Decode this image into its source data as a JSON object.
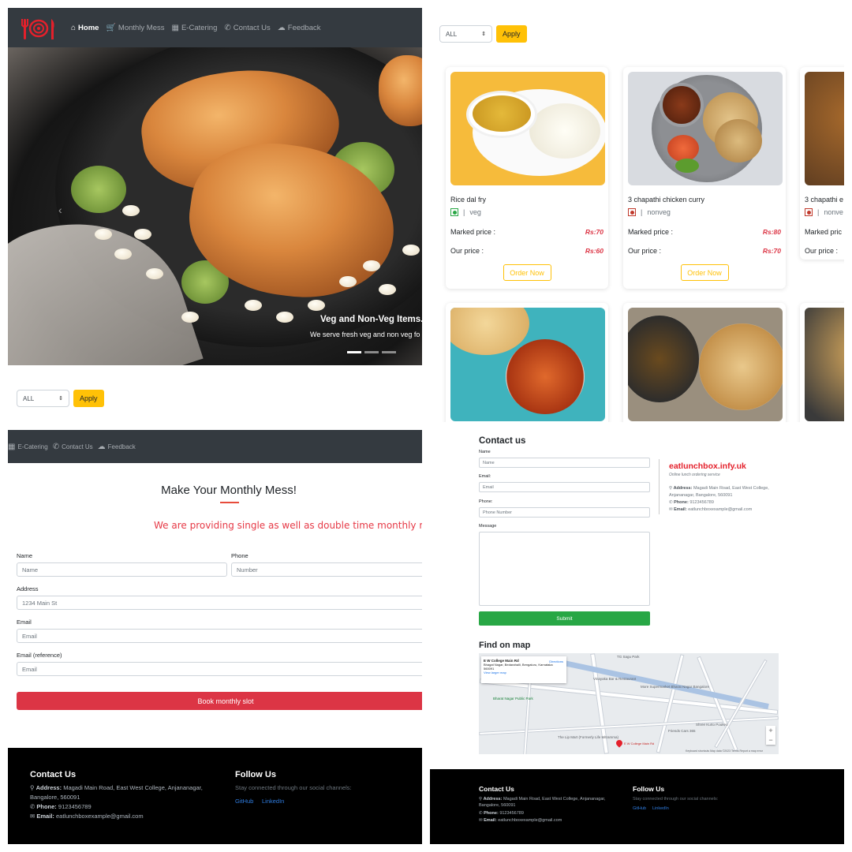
{
  "nav": {
    "items": [
      {
        "icon": "home-icon",
        "glyph": "🏠",
        "label": "Home"
      },
      {
        "icon": "cart-icon",
        "glyph": "🛒",
        "label": "Monthly Mess"
      },
      {
        "icon": "boxes-icon",
        "glyph": "📦",
        "label": "E-Catering"
      },
      {
        "icon": "phone-icon",
        "glyph": "✆",
        "label": "Contact Us"
      },
      {
        "icon": "cloud-icon",
        "glyph": "☁",
        "label": "Feedback"
      }
    ]
  },
  "hero": {
    "caption_title": "Veg and Non-Veg Items.",
    "caption_text": "We serve fresh veg and non veg fo"
  },
  "filter": {
    "selected": "ALL",
    "apply_label": "Apply"
  },
  "menu": {
    "cards": [
      {
        "name": "Rice dal fry",
        "type": "veg",
        "marked_label": "Marked price :",
        "marked": "Rs:70",
        "our_label": "Our price :",
        "our": "Rs:60",
        "order_label": "Order Now"
      },
      {
        "name": "3 chapathi chicken curry",
        "type": "nonveg",
        "marked_label": "Marked price :",
        "marked": "Rs:80",
        "our_label": "Our price :",
        "our": "Rs:70",
        "order_label": "Order Now"
      },
      {
        "name": "3 chapathi e",
        "type": "nonve",
        "marked_label": "Marked pric",
        "our_label": "Our price :"
      }
    ]
  },
  "monthly": {
    "nav_items": [
      "E-Catering",
      "Contact Us",
      "Feedback"
    ],
    "title": "Make Your Monthly Mess!",
    "subtitle": "We are providing single as well as double time monthly mess",
    "name_label": "Name",
    "name_placeholder": "Name",
    "phone_label": "Phone",
    "phone_placeholder": "Number",
    "address_label": "Address",
    "address_placeholder": "1234 Main St",
    "email_label": "Email",
    "email_placeholder": "Email",
    "email_ref_label": "Email (reference)",
    "email_ref_placeholder": "Email",
    "book_label": "Book monthly slot"
  },
  "footer": {
    "contact_title": "Contact Us",
    "address_label": "Address:",
    "address": "Magadi Main Road, East West College, Anjananagar, Bangalore, 560091",
    "phone_label": "Phone:",
    "phone": "9123456789",
    "email_label": "Email:",
    "email": "eatlunchboxexample@gmail.com",
    "follow_title": "Follow Us",
    "follow_text": "Stay connected through our social channels:",
    "github": "GitHub",
    "linkedin": "LinkedIn"
  },
  "contact": {
    "title": "Contact us",
    "name_label": "Name",
    "name_placeholder": "Name",
    "email_label": "Email:",
    "email_placeholder": "Email",
    "phone_label": "Phone:",
    "phone_placeholder": "Phone Number",
    "message_label": "Message",
    "submit_label": "Submit",
    "brand": "eatlunchbox.infy.uk",
    "brand_sub": "Online lunch ordering service",
    "address_label": "Address:",
    "address": "Magadi Main Road, East West College, Anjananagar, Bangalore, 560091",
    "phone": "9123456789",
    "email": "eatlunchboxexample@gmail.com",
    "map_title": "Find on map"
  },
  "map": {
    "place_name": "E W College Main Rd",
    "place_addr": "Bhagat Nagar, Bedarahalli, Bengaluru, Karnataka 560091",
    "directions": "Directions",
    "view_larger": "View larger map",
    "pin_label": "E W College Main Rd",
    "labels": [
      "TG Sagu Park",
      "Vinayaka Bar & Restaurant",
      "More Supermarket Bharat Nagar Bangalore",
      "Bharat Nagar Public Park",
      "Friends Cars 365",
      "The Lip Mart (Formerly Life Mitramma)",
      "Shree Kurto Poukeo"
    ],
    "footer_text": "Keyboard shortcuts   Map data ©2023   Terms   Report a map error"
  }
}
